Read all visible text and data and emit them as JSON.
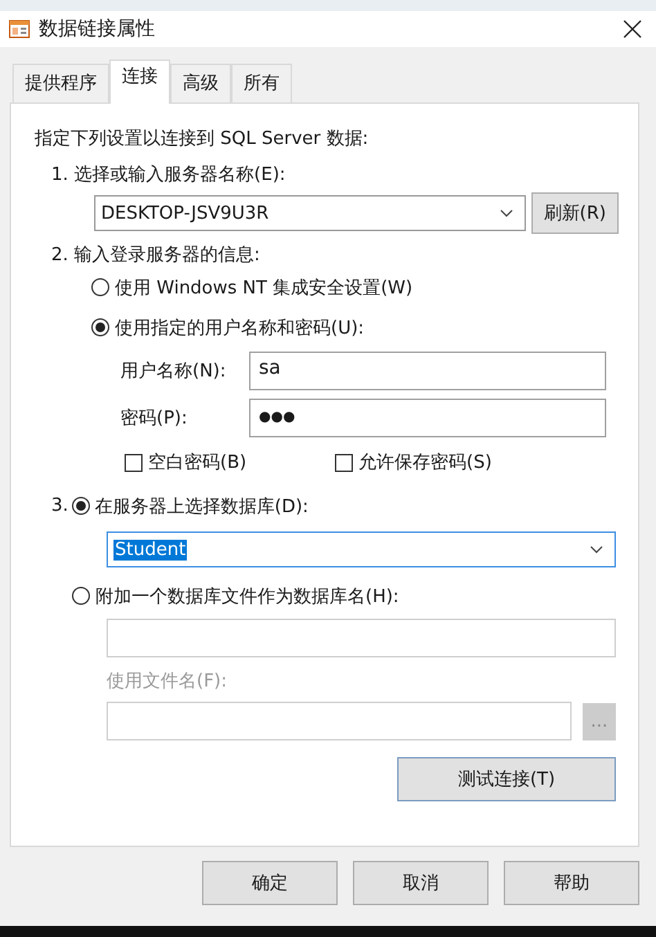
{
  "window": {
    "title": "数据链接属性"
  },
  "tabs": [
    {
      "label": "提供程序",
      "selected": false
    },
    {
      "label": "连接",
      "selected": true
    },
    {
      "label": "高级",
      "selected": false
    },
    {
      "label": "所有",
      "selected": false
    }
  ],
  "intro": "指定下列设置以连接到 SQL Server 数据:",
  "step1": {
    "label": "1. 选择或输入服务器名称(E):",
    "server": "DESKTOP-JSV9U3R",
    "refresh_button": "刷新(R)"
  },
  "step2": {
    "label": "2. 输入登录服务器的信息:",
    "auth_options": [
      {
        "label": "使用 Windows NT 集成安全设置(W)",
        "selected": false
      },
      {
        "label": "使用指定的用户名称和密码(U):",
        "selected": true
      }
    ],
    "username_label": "用户名称(N):",
    "username": "sa",
    "password_label": "密码(P):",
    "password": "●●●",
    "checkboxes": [
      {
        "label": "空白密码(B)",
        "checked": false
      },
      {
        "label": "允许保存密码(S)",
        "checked": false
      }
    ]
  },
  "step3": {
    "number": "3.",
    "options": [
      {
        "label": "在服务器上选择数据库(D):",
        "selected": true
      },
      {
        "label": "附加一个数据库文件作为数据库名(H):",
        "selected": false
      }
    ],
    "database": "Student",
    "database_highlighted": true,
    "attach_disabled": true,
    "filename_label": "使用文件名(F):",
    "browse_button": "...",
    "test_button": "测试连接(T)"
  },
  "buttons": [
    "确定",
    "取消",
    "帮助"
  ]
}
